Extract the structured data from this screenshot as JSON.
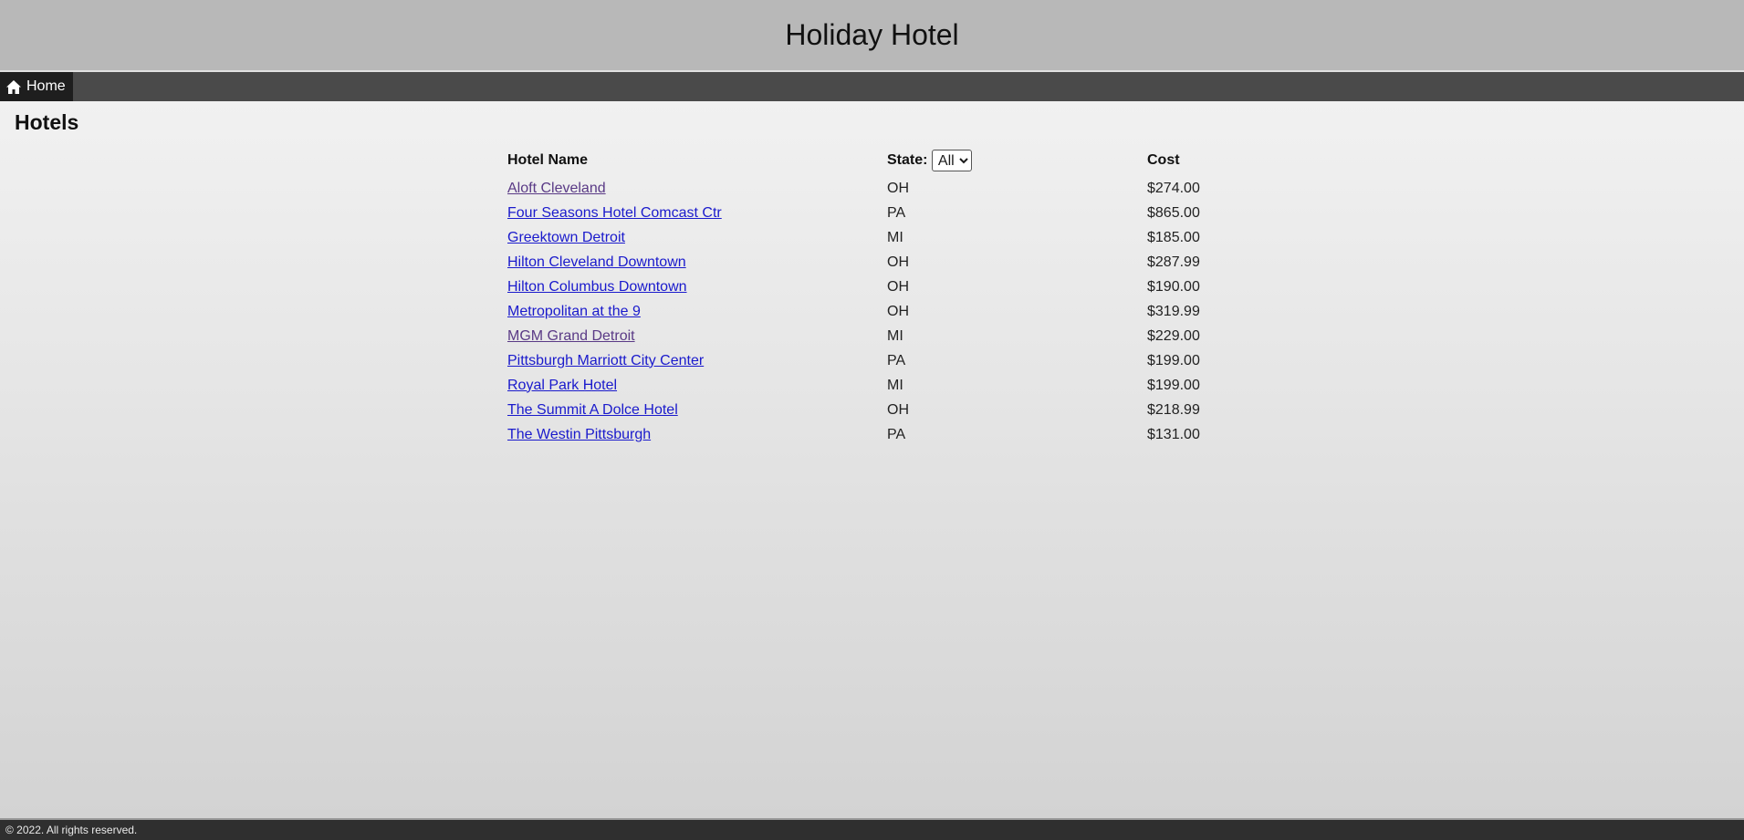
{
  "site": {
    "title": "Holiday Hotel"
  },
  "nav": {
    "home_label": "Home",
    "home_icon": "home-icon"
  },
  "page": {
    "heading": "Hotels"
  },
  "table": {
    "headers": {
      "name": "Hotel Name",
      "state": "State:",
      "cost": "Cost"
    },
    "state_filter": {
      "selected": "All",
      "options": [
        "All"
      ]
    },
    "rows": [
      {
        "name": "Aloft Cleveland",
        "state": "OH",
        "cost": "$274.00",
        "visited": true
      },
      {
        "name": "Four Seasons Hotel Comcast Ctr",
        "state": "PA",
        "cost": "$865.00",
        "visited": false
      },
      {
        "name": "Greektown Detroit",
        "state": "MI",
        "cost": "$185.00",
        "visited": false
      },
      {
        "name": "Hilton Cleveland Downtown",
        "state": "OH",
        "cost": "$287.99",
        "visited": false
      },
      {
        "name": "Hilton Columbus Downtown",
        "state": "OH",
        "cost": "$190.00",
        "visited": false
      },
      {
        "name": "Metropolitan at the 9",
        "state": "OH",
        "cost": "$319.99",
        "visited": false
      },
      {
        "name": "MGM Grand Detroit",
        "state": "MI",
        "cost": "$229.00",
        "visited": true
      },
      {
        "name": "Pittsburgh Marriott City Center",
        "state": "PA",
        "cost": "$199.00",
        "visited": false
      },
      {
        "name": "Royal Park Hotel",
        "state": "MI",
        "cost": "$199.00",
        "visited": false
      },
      {
        "name": "The Summit A Dolce Hotel",
        "state": "OH",
        "cost": "$218.99",
        "visited": false
      },
      {
        "name": "The Westin Pittsburgh",
        "state": "PA",
        "cost": "$131.00",
        "visited": false
      }
    ]
  },
  "footer": {
    "text": "© 2022. All rights reserved."
  },
  "colors": {
    "header_bg": "#b8b8b8",
    "nav_bg": "#4a4a4a",
    "nav_active_bg": "#1e1e1e",
    "link": "#1a1acc",
    "link_visited": "#5a3a86",
    "footer_bg": "#2f2f2f"
  }
}
